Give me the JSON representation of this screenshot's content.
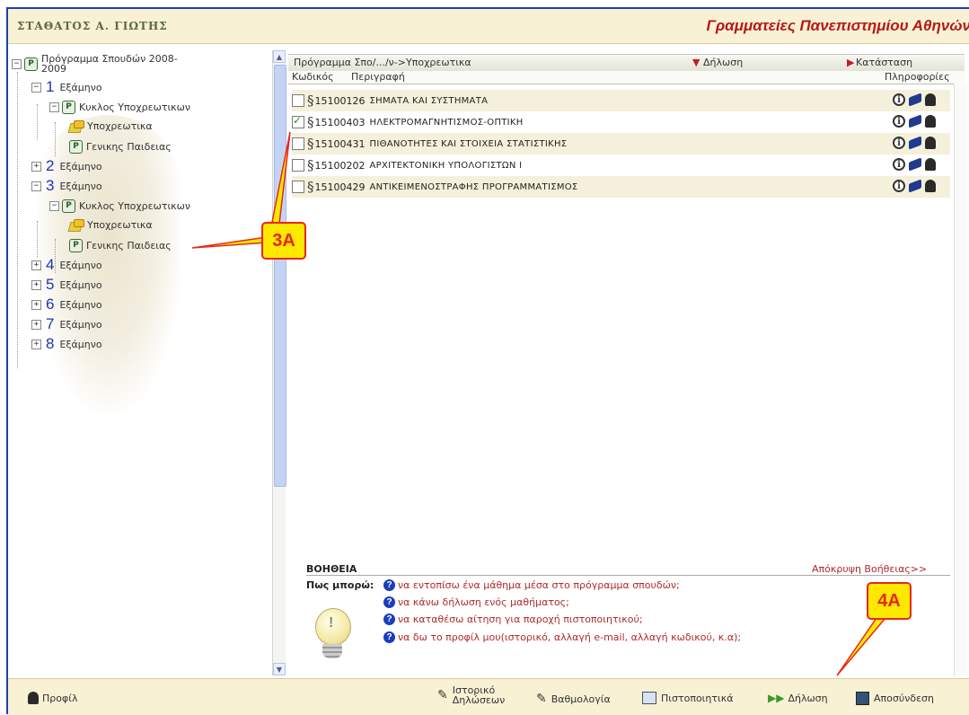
{
  "header": {
    "logo_text": "ΣΤΑΘΑΤΟΣ Α. ΓΙΩΤΗΣ",
    "site_title": "Γραμματείες Πανεπιστημίου Αθηνών"
  },
  "tree": {
    "root_label": "Πρόγραμμα Σπουδών 2008-",
    "root_label_line2": "2009",
    "semester_word": "Εξάμηνο",
    "cycle_label": "Κυκλος Υποχρεωτικων",
    "mandatory_label": "Υποχρεωτικα",
    "general_label": "Γενικης Παιδειας",
    "semesters": [
      "1",
      "2",
      "3",
      "4",
      "5",
      "6",
      "7",
      "8"
    ]
  },
  "grid": {
    "path": "Πρόγραμμα Σπο/.../ν->Υποχρεωτικα",
    "declaration": "Δήλωση",
    "status": "Κατάσταση",
    "col_code": "Κωδικός",
    "col_desc": "Περιγραφή",
    "col_info": "Πληροφορίες",
    "rows": [
      {
        "code": "15100126",
        "name": "ΣΗΜΑΤΑ ΚΑΙ ΣΥΣΤΗΜΑΤΑ",
        "checked": false
      },
      {
        "code": "15100403",
        "name": "ΗΛΕΚΤΡΟΜΑΓΝΗΤΙΣΜΟΣ-ΟΠΤΙΚΗ",
        "checked": true
      },
      {
        "code": "15100431",
        "name": "ΠΙΘΑΝΟΤΗΤΕΣ ΚΑΙ ΣΤΟΙΧΕΙΑ ΣΤΑΤΙΣΤΙΚΗΣ",
        "checked": false
      },
      {
        "code": "15100202",
        "name": "ΑΡΧΙΤΕΚΤΟΝΙΚΗ ΥΠΟΛΟΓΙΣΤΩΝ Ι",
        "checked": false
      },
      {
        "code": "15100429",
        "name": "ΑΝΤΙΚΕΙΜΕΝΟΣΤΡΑΦΗΣ ΠΡΟΓΡΑΜΜΑΤΙΣΜΟΣ",
        "checked": false
      }
    ]
  },
  "help": {
    "title": "ΒΟΗΘΕΙΑ",
    "hide": "Απόκρυψη Βοήθειας>>",
    "how_can": "Πως μπορώ:",
    "items": [
      "να εντοπίσω ένα μάθημα μέσα στο πρόγραμμα σπουδών;",
      "να κάνω δήλωση ενός μαθήματος;",
      "να καταθέσω αίτηση για παροχή πιστοποιητικού;",
      "να δω το προφίλ μου(ιστορικό, αλλαγή e-mail, αλλαγή κωδικού, κ.α);"
    ]
  },
  "footer": {
    "profile": "Προφίλ",
    "history_l1": "Ιστορικό",
    "history_l2": "Δηλώσεων",
    "grades": "Βαθμολογία",
    "certificates": "Πιστοποιητικά",
    "declaration": "Δήλωση",
    "logout": "Αποσύνδεση"
  },
  "annotations": {
    "a1": "3A",
    "a2": "4A"
  },
  "colors": {
    "accent_blue": "#1b3fae",
    "title_red": "#b51919",
    "annotation_fill": "#fde800",
    "annotation_red": "#e8261c"
  }
}
